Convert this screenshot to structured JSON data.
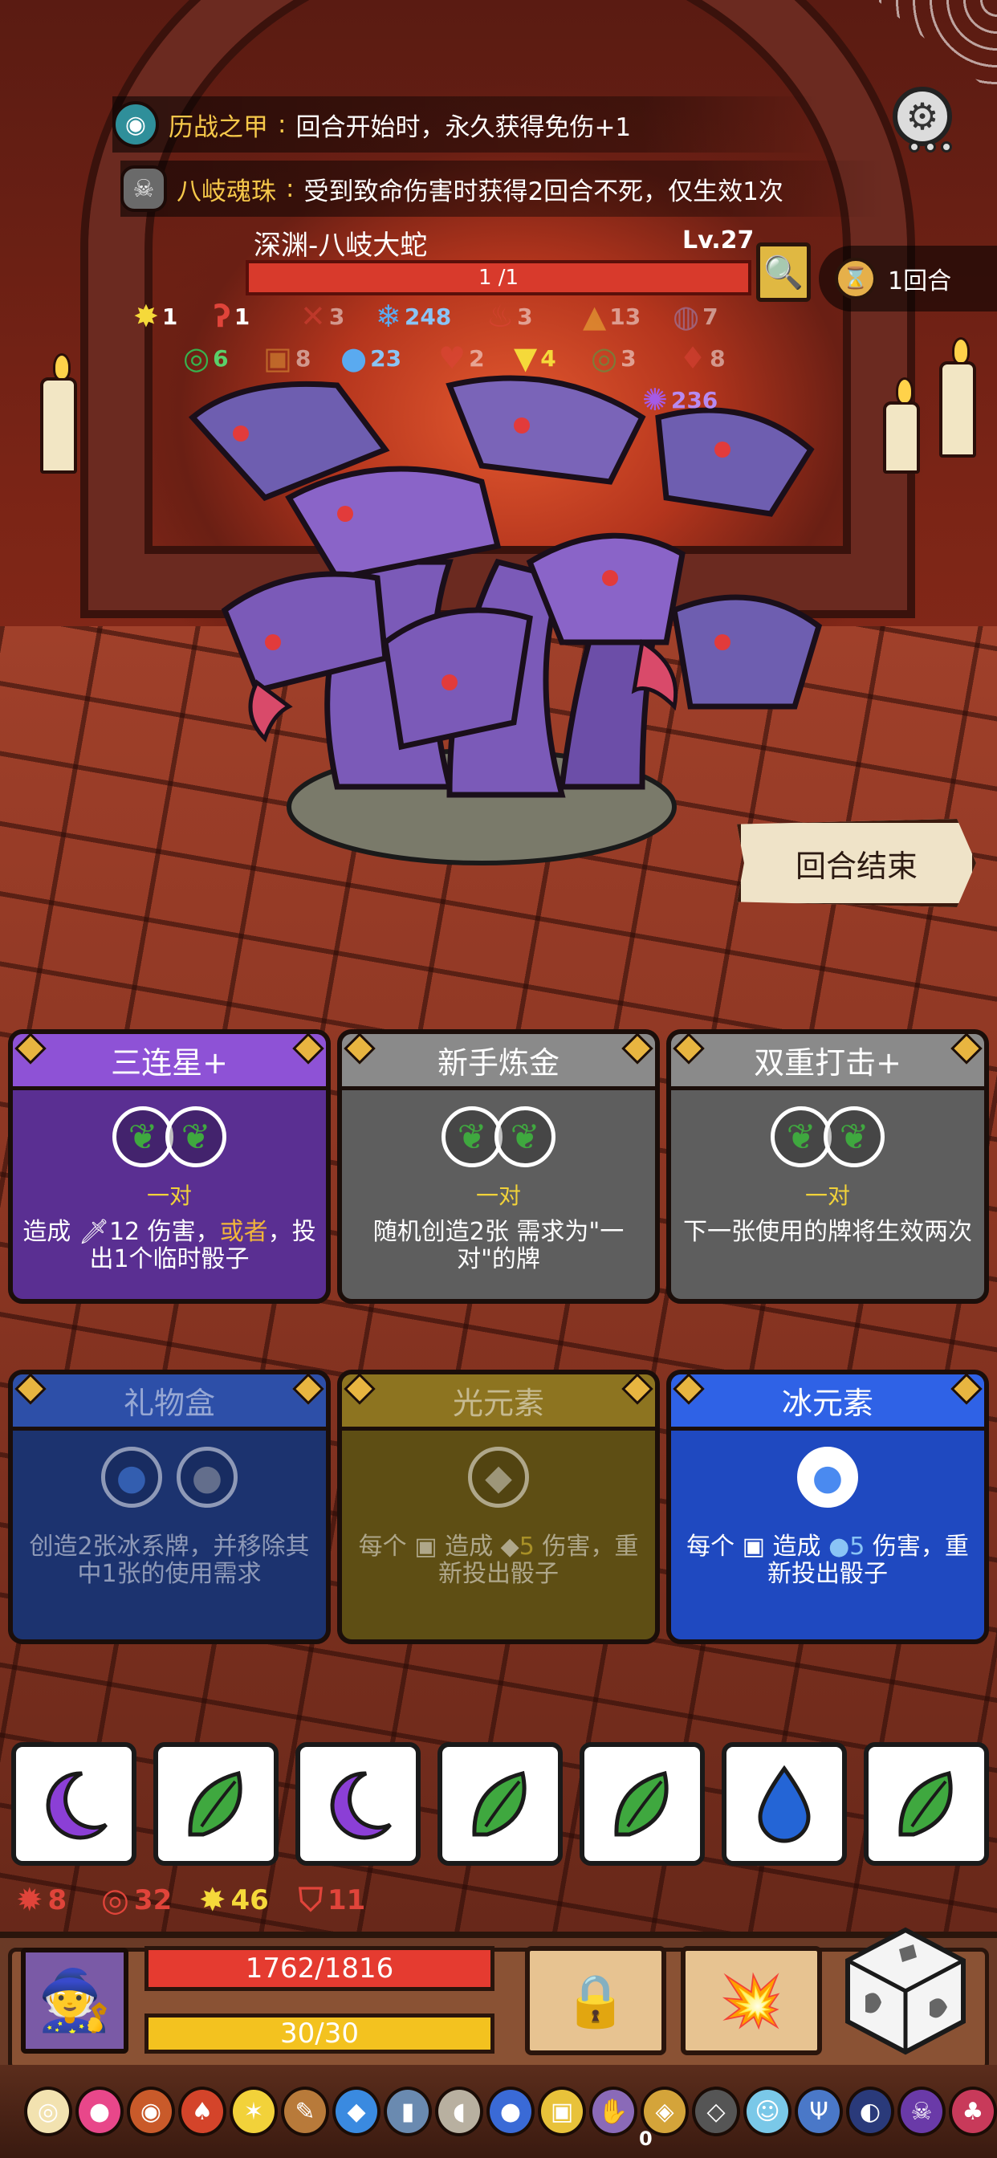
{
  "buffs": [
    {
      "icon": "shield-eye-icon",
      "name": "历战之甲",
      "sep": ":",
      "desc": "回合开始时，永久获得免伤+1"
    },
    {
      "icon": "hydra-orb-icon",
      "name": "八岐魂珠",
      "sep": ":",
      "desc": "受到致命伤害时获得2回合不死，仅生效1次"
    }
  ],
  "boss": {
    "name": "深渊-八岐大蛇",
    "level": "Lv.27",
    "hp": "1 /1",
    "turn": "1回合"
  },
  "boss_status": [
    {
      "icon": "star-icon",
      "value": "1",
      "color": "#f5d93a",
      "dim": false
    },
    {
      "icon": "hook-icon",
      "value": "1",
      "color": "#e0443a",
      "dim": false
    },
    {
      "icon": "blade-icon",
      "value": "3",
      "color": "#e0443a",
      "dim": true
    },
    {
      "icon": "snowflake-icon",
      "value": "248",
      "color": "#5aaaf0",
      "dim": false
    },
    {
      "icon": "blood-icon",
      "value": "3",
      "color": "#e0443a",
      "dim": true
    },
    {
      "icon": "pyramid-icon",
      "value": "13",
      "color": "#f5c53a",
      "dim": true
    },
    {
      "icon": "speech-icon",
      "value": "7",
      "color": "#9b8fd0",
      "dim": true
    },
    {
      "icon": "swirl-icon",
      "value": "6",
      "color": "#37b24d",
      "dim": false
    },
    {
      "icon": "lock-icon",
      "value": "8",
      "color": "#e8a23a",
      "dim": true
    },
    {
      "icon": "bubble-icon",
      "value": "23",
      "color": "#5aaaf0",
      "dim": false
    },
    {
      "icon": "heart-down-icon",
      "value": "2",
      "color": "#e0443a",
      "dim": true
    },
    {
      "icon": "triangle-icon",
      "value": "4",
      "color": "#f5d93a",
      "dim": false
    },
    {
      "icon": "swirl-icon",
      "value": "3",
      "color": "#37b24d",
      "dim": true
    },
    {
      "icon": "flame-icon",
      "value": "8",
      "color": "#e0443a",
      "dim": true
    },
    {
      "icon": "spark-icon",
      "value": "236",
      "color": "#a45ae6",
      "dim": false
    }
  ],
  "end_turn_label": "回合结束",
  "cards": [
    {
      "title": "三连星+",
      "req": "一对",
      "desc_pre": "造成 ",
      "desc_dmg": "12",
      "desc_mid": " 伤害，",
      "desc_or": "或者",
      "desc_post": "，投出1个临时骰子",
      "theme": "#6b3aa8",
      "head": "#8e52d6"
    },
    {
      "title": "新手炼金",
      "req": "一对",
      "desc": "随机创造2张 需求为\"一对\"的牌",
      "theme": "#6a6a6a",
      "head": "#8a8a8a"
    },
    {
      "title": "双重打击+",
      "req": "一对",
      "desc": "下一张使用的牌将生效两次",
      "theme": "#6a6a6a",
      "head": "#8a8a8a"
    },
    {
      "title": "礼物盒",
      "req": "",
      "desc": "创造2张冰系牌，并移除其中1张的使用需求",
      "theme": "#1f3a86",
      "head": "#2d4fa8",
      "dim": true
    },
    {
      "title": "光元素",
      "req": "",
      "desc_pre": "每个 ",
      "desc_mid": " 造成 ",
      "desc_dmg": "5",
      "desc_post": " 伤害，重新投出骰子",
      "theme": "#6e5a16",
      "head": "#8d7420",
      "dim": true
    },
    {
      "title": "冰元素",
      "req": "",
      "desc_pre": "每个 ",
      "desc_mid": " 造成 ",
      "desc_dmg": "5",
      "desc_post": " 伤害，重新投出骰子",
      "theme": "#1f49c0",
      "head": "#2f62e6"
    }
  ],
  "dice": [
    "moon",
    "leaf",
    "moon",
    "leaf",
    "leaf",
    "drop",
    "leaf"
  ],
  "player_stats": [
    {
      "icon": "gear-burst-icon",
      "value": "8",
      "color": "#e0443a"
    },
    {
      "icon": "spiral-icon",
      "value": "32",
      "color": "#e0443a"
    },
    {
      "icon": "star-icon",
      "value": "46",
      "color": "#f5d93a"
    },
    {
      "icon": "shield-icon",
      "value": "11",
      "color": "#e0443a"
    }
  ],
  "player": {
    "hp": "1762/1816",
    "energy": "30/30"
  },
  "relic_count": "0",
  "colors": {
    "hp_red": "#e53b30",
    "energy_yellow": "#f3c21f",
    "leaf_green": "#3fa83f",
    "moon_purple": "#8b3fd6",
    "drop_blue": "#2465d6"
  }
}
